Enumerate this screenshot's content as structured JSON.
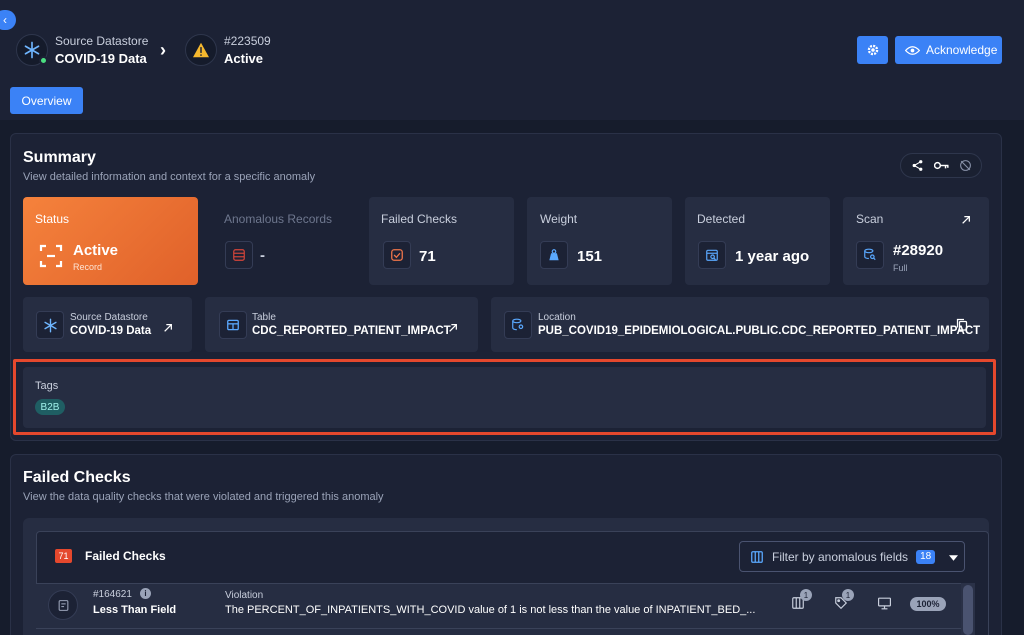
{
  "header": {
    "source_label": "Source Datastore",
    "source_name": "COVID-19 Data",
    "anomaly_id": "#223509",
    "anomaly_status": "Active",
    "acknowledge_label": "Acknowledge"
  },
  "tabs": {
    "overview": "Overview"
  },
  "summary": {
    "title": "Summary",
    "description": "View detailed information and context for a specific anomaly",
    "status": {
      "label": "Status",
      "value": "Active",
      "sub": "Record"
    },
    "anomalous_records": {
      "label": "Anomalous Records",
      "value": "-"
    },
    "failed_checks": {
      "label": "Failed Checks",
      "value": "71"
    },
    "weight": {
      "label": "Weight",
      "value": "151"
    },
    "detected": {
      "label": "Detected",
      "value": "1 year ago"
    },
    "scan": {
      "label": "Scan",
      "value": "#28920",
      "sub": "Full"
    },
    "source": {
      "label": "Source Datastore",
      "value": "COVID-19 Data"
    },
    "table": {
      "label": "Table",
      "value": "CDC_REPORTED_PATIENT_IMPACT"
    },
    "location": {
      "label": "Location",
      "value": "PUB_COVID19_EPIDEMIOLOGICAL.PUBLIC.CDC_REPORTED_PATIENT_IMPACT"
    },
    "tags": {
      "label": "Tags",
      "items": [
        "B2B"
      ]
    }
  },
  "failed_checks": {
    "title": "Failed Checks",
    "description": "View the data quality checks that were violated and triggered this anomaly",
    "count": "71",
    "list_title": "Failed Checks",
    "filter_label": "Filter by anomalous fields",
    "filter_count": "18",
    "rows": [
      {
        "id": "#164621",
        "rule": "Less Than Field",
        "violation_label": "Violation",
        "violation_text": "The PERCENT_OF_INPATIENTS_WITH_COVID value of 1 is not less than the value of INPATIENT_BED_...",
        "fields_badge": "1",
        "tags_badge": "1",
        "coverage": "100%"
      }
    ]
  },
  "colors": {
    "accent": "#3b82f6",
    "status": "#f07a36",
    "highlight": "#e5482d",
    "tag": "#1f5e63"
  }
}
